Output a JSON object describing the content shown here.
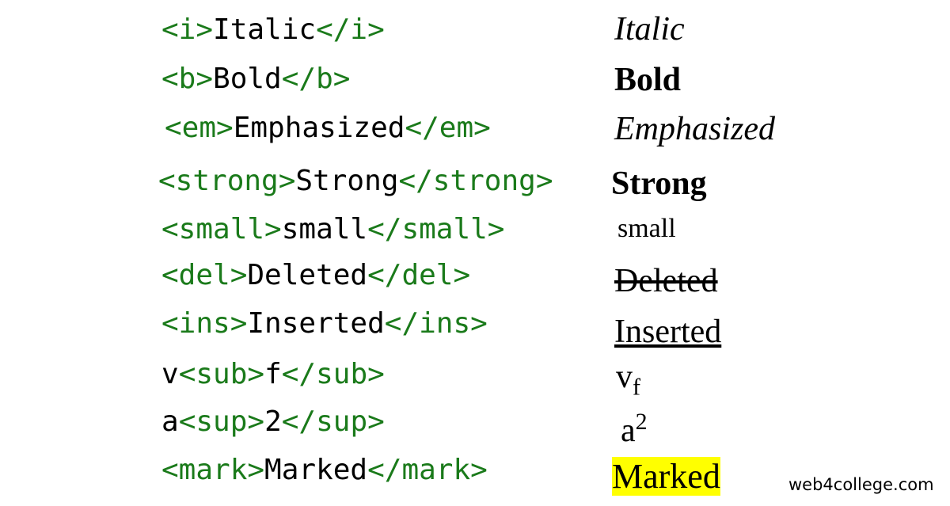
{
  "rows": [
    {
      "open": "<i>",
      "text": "Italic",
      "close": "</i>",
      "rendered": "Italic"
    },
    {
      "open": "<b>",
      "text": "Bold",
      "close": "</b>",
      "rendered": "Bold"
    },
    {
      "open": "<em>",
      "text": "Emphasized",
      "close": "</em>",
      "rendered": "Emphasized"
    },
    {
      "open": "<strong>",
      "text": "Strong",
      "close": "</strong>",
      "rendered": "Strong"
    },
    {
      "open": "<small>",
      "text": "small",
      "close": "</small>",
      "rendered": "small"
    },
    {
      "open": "<del>",
      "text": "Deleted",
      "close": "</del>",
      "rendered": "Deleted"
    },
    {
      "open": "<ins>",
      "text": "Inserted",
      "close": "</ins>",
      "rendered": "Inserted"
    },
    {
      "pre": "v",
      "open": "<sub>",
      "text": "f",
      "close": "</sub>",
      "rendered_base": "v",
      "rendered_script": "f"
    },
    {
      "pre": "a",
      "open": "<sup>",
      "text": "2",
      "close": "</sup>",
      "rendered_base": "a",
      "rendered_script": "2"
    },
    {
      "open": "<mark>",
      "text": "Marked",
      "close": "</mark>",
      "rendered": "Marked"
    }
  ],
  "colors": {
    "tag": "#1a7a1a",
    "mark": "#ffff00"
  },
  "watermark": "web4college.com"
}
